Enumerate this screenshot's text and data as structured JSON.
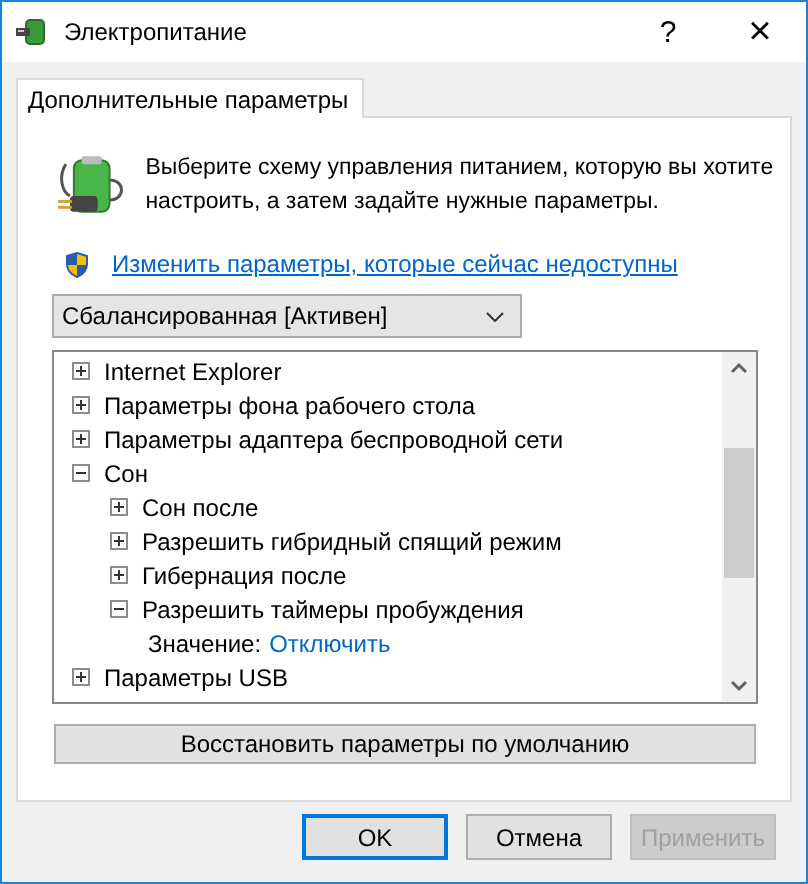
{
  "window": {
    "title": "Электропитание",
    "help": "?",
    "close": "×"
  },
  "tabs": [
    {
      "label": "Дополнительные параметры",
      "selected": true
    }
  ],
  "intro": "Выберите схему управления питанием, которую вы хотите настроить, а затем задайте нужные параметры.",
  "change_link": "Изменить параметры, которые сейчас недоступны",
  "plan": {
    "value": "Сбалансированная [Активен]"
  },
  "tree": [
    {
      "kind": "group",
      "label": "Internet Explorer",
      "expanded": false
    },
    {
      "kind": "group",
      "label": "Параметры фона рабочего стола",
      "expanded": false
    },
    {
      "kind": "group",
      "label": "Параметры адаптера беспроводной сети",
      "expanded": false
    },
    {
      "kind": "group",
      "label": "Сон",
      "expanded": true,
      "children": [
        {
          "kind": "group",
          "label": "Сон после",
          "expanded": false
        },
        {
          "kind": "group",
          "label": "Разрешить гибридный спящий режим",
          "expanded": false
        },
        {
          "kind": "group",
          "label": "Гибернация после",
          "expanded": false
        },
        {
          "kind": "group",
          "label": "Разрешить таймеры пробуждения",
          "expanded": true,
          "children": [
            {
              "kind": "value",
              "label": "Значение:",
              "value": "Отключить"
            }
          ]
        }
      ]
    },
    {
      "kind": "group",
      "label": "Параметры USB",
      "expanded": false
    }
  ],
  "restore_button": "Восстановить параметры по умолчанию",
  "buttons": [
    {
      "label": "OK",
      "default": true,
      "disabled": false
    },
    {
      "label": "Отмена",
      "default": false,
      "disabled": false
    },
    {
      "label": "Применить",
      "default": false,
      "disabled": true
    }
  ]
}
